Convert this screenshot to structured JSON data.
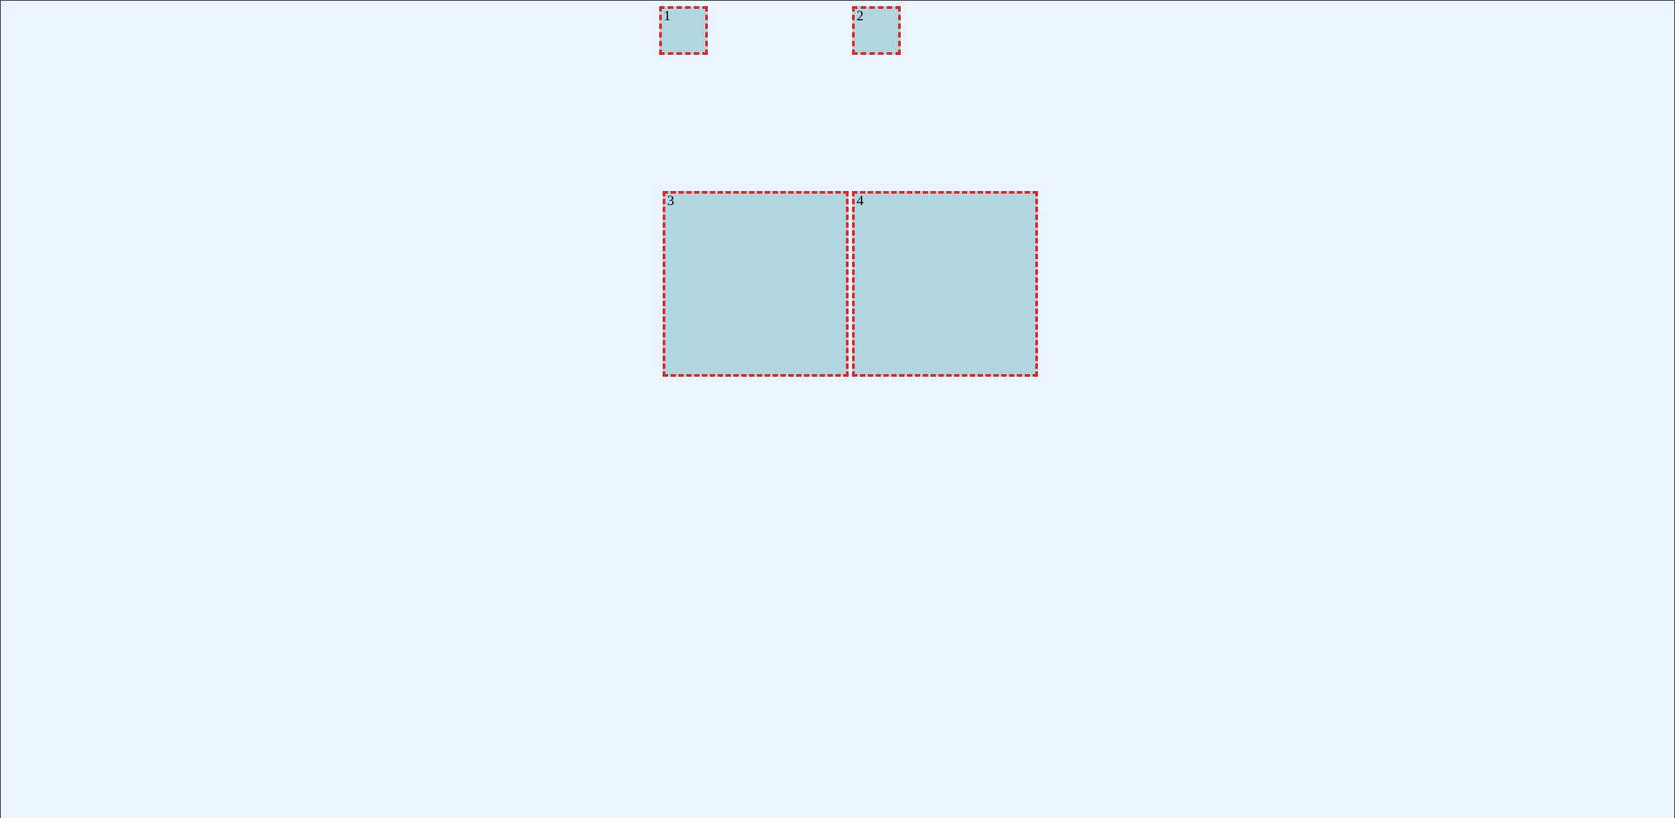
{
  "boxes": {
    "b1": {
      "label": "1"
    },
    "b2": {
      "label": "2"
    },
    "b3": {
      "label": "3"
    },
    "b4": {
      "label": "4"
    }
  },
  "colors": {
    "background": "#ebf5ff",
    "boxFill": "#b0d7e0",
    "boxBorder": "#ee2222"
  }
}
